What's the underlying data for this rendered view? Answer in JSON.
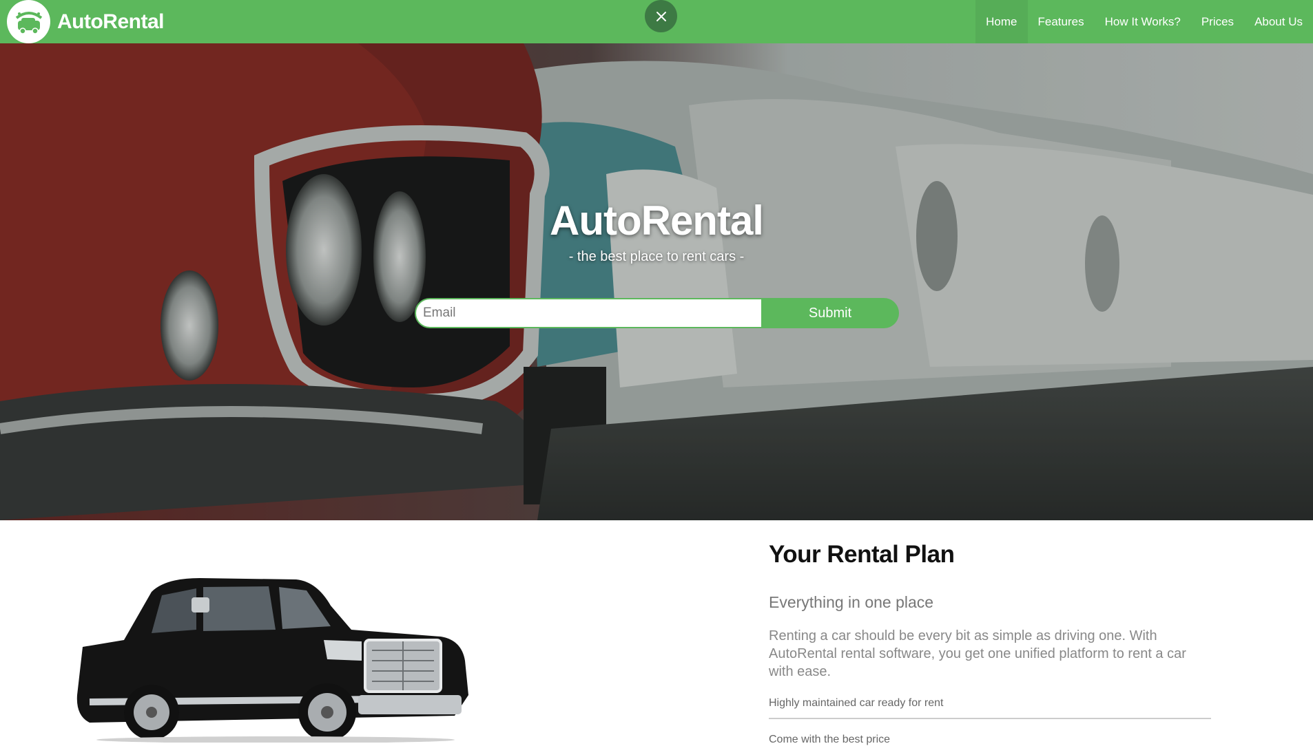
{
  "nav": {
    "brand": "AutoRental",
    "items": [
      {
        "label": "Home",
        "active": true
      },
      {
        "label": "Features"
      },
      {
        "label": "How It Works?"
      },
      {
        "label": "Prices"
      },
      {
        "label": "About Us"
      }
    ]
  },
  "hero": {
    "title": "AutoRental",
    "subtitle": "- the best place to rent cars -",
    "email_placeholder": "Email",
    "submit_label": "Submit"
  },
  "plan": {
    "title": "Your Rental Plan",
    "subtitle": "Everything in one place",
    "description": "Renting a car should be every bit as simple as driving one. With AutoRental rental software, you get one unified platform to rent a car with ease.",
    "features": [
      "Highly maintained car ready for rent",
      "Come with the best price"
    ]
  },
  "colors": {
    "accent": "#5cb85c",
    "close_button": "#3d7a44"
  },
  "icons": {
    "logo": "car-wash-logo-icon",
    "close": "close-icon"
  }
}
